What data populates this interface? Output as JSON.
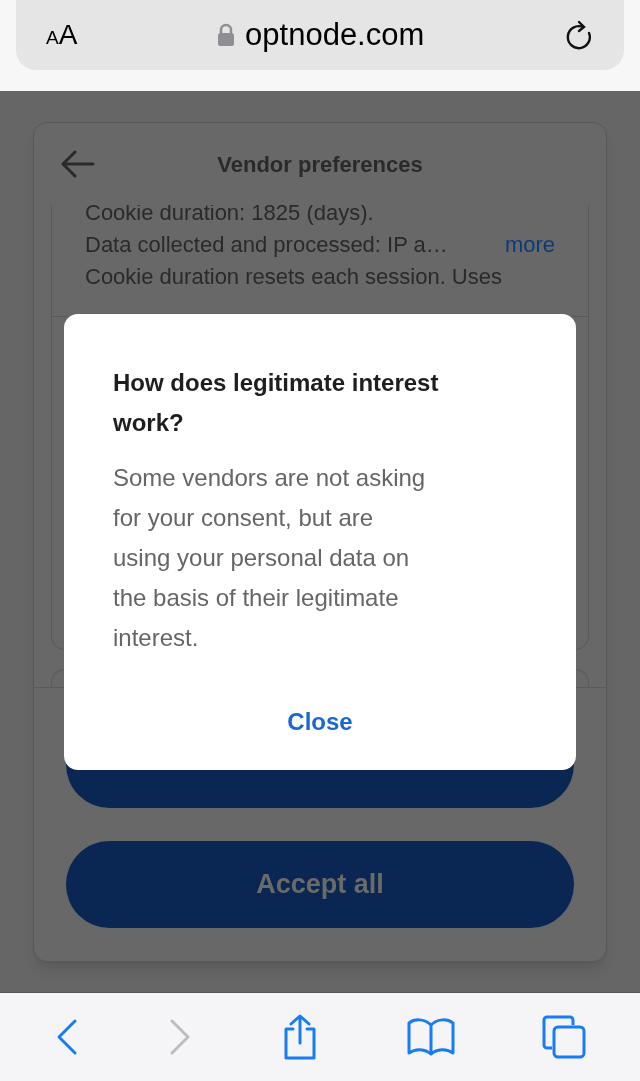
{
  "browser": {
    "text_size_label": "AA",
    "url": "optnode.com",
    "secure": true
  },
  "page": {
    "title": "Vendor preferences",
    "vendor_details": [
      {
        "kind": "text",
        "text": "Cookie duration: 1825 (days)."
      },
      {
        "kind": "truncated",
        "text": "Data collected and processed: IP a…",
        "link": "more"
      },
      {
        "kind": "text",
        "text": "Cookie duration resets each session. Uses"
      }
    ],
    "buttons": [
      {
        "kind": "blank"
      },
      {
        "kind": "labelled",
        "label": "Accept all"
      }
    ]
  },
  "dialog": {
    "title": "How does legitimate interest work?",
    "body": "Some vendors are not asking for your consent, but are using your personal data on the basis of their legitimate interest.",
    "button": "Close"
  },
  "toolbar": [
    {
      "kind": "back",
      "disabled": false
    },
    {
      "kind": "forward",
      "disabled": true
    },
    {
      "kind": "share"
    },
    {
      "kind": "bookmarks"
    },
    {
      "kind": "tabs"
    }
  ]
}
